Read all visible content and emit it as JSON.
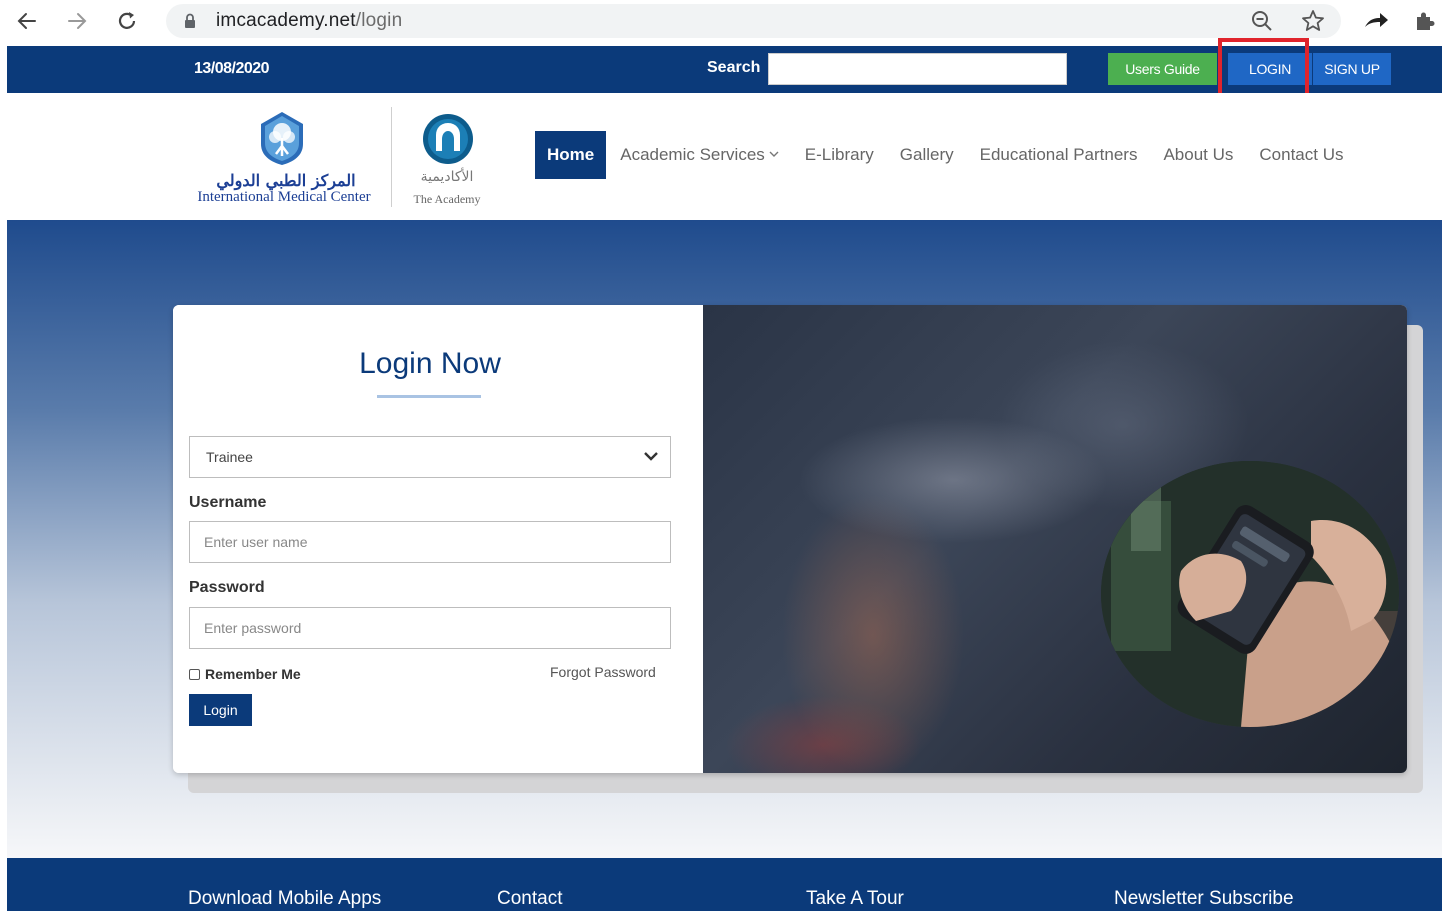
{
  "browser": {
    "url_host": "imcacademy.net",
    "url_path": "/login"
  },
  "topbar": {
    "date": "13/08/2020",
    "search_label": "Search",
    "search_value": "",
    "users_guide": "Users Guide",
    "login": "LOGIN",
    "signup": "SIGN UP"
  },
  "header": {
    "imc_name_ar": "المركز الطبي الدولي",
    "imc_name_en": "International Medical Center",
    "academy_name_ar": "الأكاديمية",
    "academy_name_en": "The Academy",
    "nav": [
      {
        "label": "Home",
        "active": true
      },
      {
        "label": "Academic Services"
      },
      {
        "label": "E-Library"
      },
      {
        "label": "Gallery"
      },
      {
        "label": "Educational Partners"
      },
      {
        "label": "About Us"
      },
      {
        "label": "Contact Us"
      }
    ]
  },
  "login_form": {
    "title": "Login Now",
    "role_selected": "Trainee",
    "username_label": "Username",
    "username_placeholder": "Enter user name",
    "password_label": "Password",
    "password_placeholder": "Enter password",
    "remember_label": "Remember Me",
    "remember_checked": false,
    "forgot_label": "Forgot Password",
    "submit_label": "Login"
  },
  "footer": {
    "columns": [
      "Download Mobile Apps",
      "Contact",
      "Take A Tour",
      "Newsletter Subscribe"
    ]
  },
  "colors": {
    "brand_navy": "#0b3a7a",
    "guide_green": "#4caf50",
    "login_blue": "#1f67c5",
    "highlight_red": "#e0242c"
  }
}
